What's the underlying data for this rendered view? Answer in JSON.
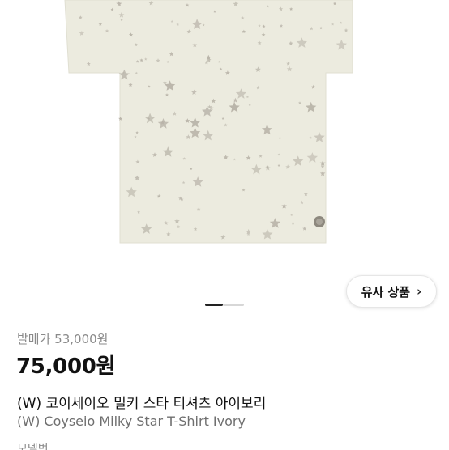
{
  "product": {
    "image_alt": "Ivory t-shirt with grey star print",
    "colors": {
      "shirt": "#ecebdf",
      "star": "#b7b2a7",
      "badge": "#8d887e"
    }
  },
  "similar_button": {
    "label": "유사 상품",
    "icon": "chevron-right-icon"
  },
  "carousel": {
    "current": 1,
    "total": 2
  },
  "pricing": {
    "original": "발매가 53,000원",
    "price": "75,000원"
  },
  "titles": {
    "korean": "(W) 코이세이오 밀키 스타 티셔츠 아이보리",
    "english": "(W) Coyseio Milky Star T-Shirt Ivory"
  },
  "cutoff_text": "모델번"
}
